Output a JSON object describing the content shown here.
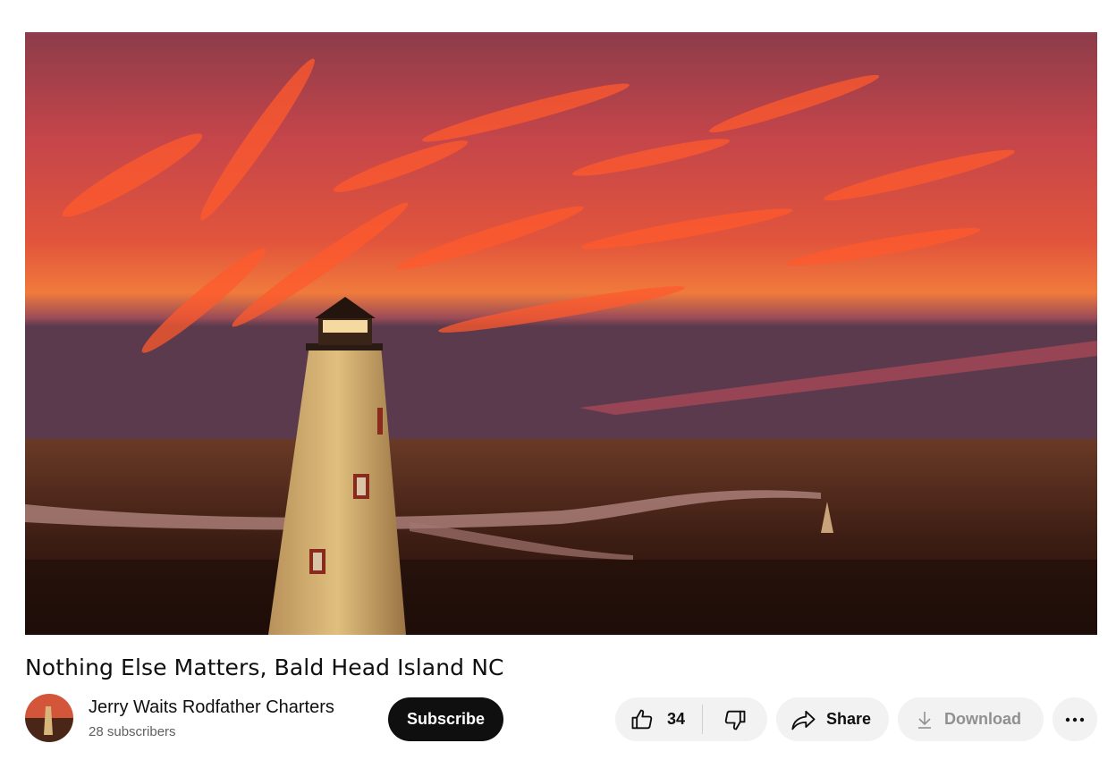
{
  "video": {
    "title": "Nothing Else Matters, Bald Head Island NC",
    "thumbnail_description_icon": "lighthouse-sunset-scene"
  },
  "channel": {
    "name": "Jerry Waits Rodfather Charters",
    "subscribers": "28 subscribers",
    "subscribe_label": "Subscribe"
  },
  "actions": {
    "like_count": "34",
    "like_icon": "thumbs-up-icon",
    "dislike_icon": "thumbs-down-icon",
    "share_label": "Share",
    "share_icon": "share-arrow-icon",
    "download_label": "Download",
    "download_icon": "download-icon",
    "more_icon": "more-horizontal-icon"
  },
  "colors": {
    "subscribe_bg": "#0f0f0f",
    "pill_bg": "#f2f2f2",
    "muted_text": "#606060",
    "disabled_text": "#909090"
  }
}
